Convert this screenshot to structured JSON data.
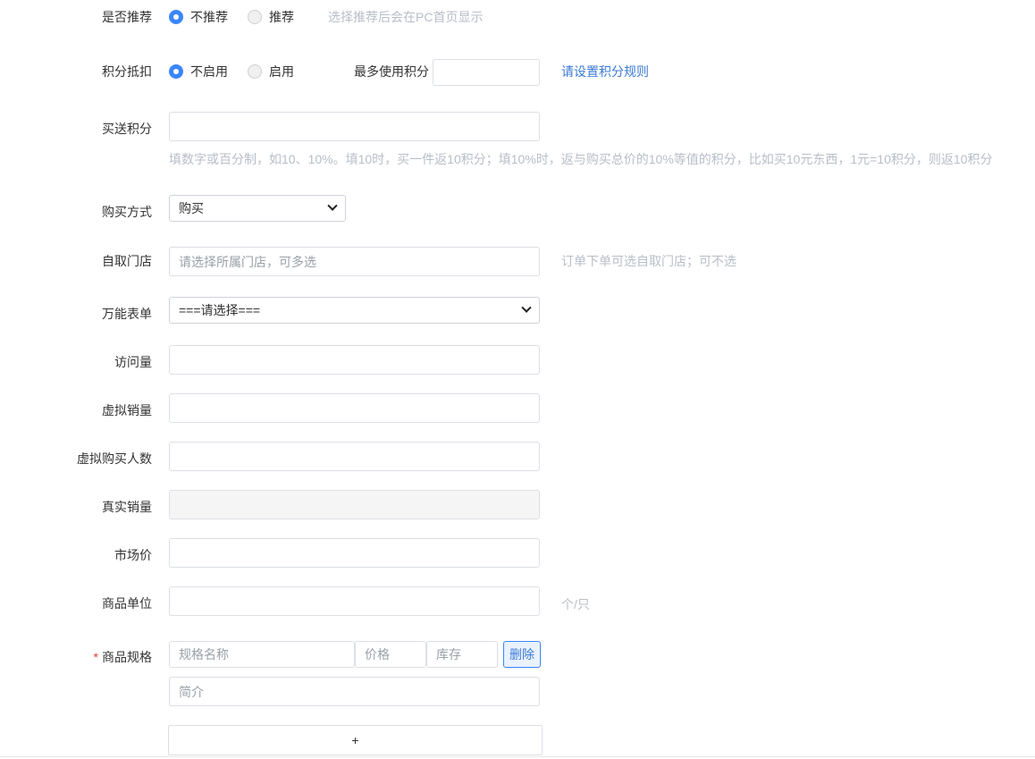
{
  "recommend": {
    "label": "是否推荐",
    "option_no": "不推荐",
    "option_yes": "推荐",
    "selected": "不推荐",
    "hint": "选择推荐后会在PC首页显示"
  },
  "points_deduct": {
    "label": "积分抵扣",
    "option_off": "不启用",
    "option_on": "启用",
    "selected": "不启用",
    "max_label": "最多使用积分",
    "max_value": "",
    "rules_link": "请设置积分规则"
  },
  "gift_points": {
    "label": "买送积分",
    "value": "",
    "hint": "填数字或百分制，如10、10%。填10时，买一件返10积分；填10%时，返与购买总价的10%等值的积分，比如买10元东西，1元=10积分，则返10积分"
  },
  "purchase_method": {
    "label": "购买方式",
    "selected": "购买"
  },
  "pickup_store": {
    "label": "自取门店",
    "placeholder": "请选择所属门店，可多选",
    "hint": "订单下单可选自取门店；可不选"
  },
  "universal_form": {
    "label": "万能表单",
    "selected": "===请选择==="
  },
  "views": {
    "label": "访问量",
    "value": ""
  },
  "virtual_sales": {
    "label": "虚拟销量",
    "value": ""
  },
  "virtual_buyers": {
    "label": "虚拟购买人数",
    "value": ""
  },
  "real_sales": {
    "label": "真实销量",
    "value": ""
  },
  "market_price": {
    "label": "市场价",
    "value": ""
  },
  "unit": {
    "label": "商品单位",
    "value": "",
    "hint": "个/只"
  },
  "spec": {
    "required_mark": "*",
    "label": "商品规格",
    "name_placeholder": "规格名称",
    "price_placeholder": "价格",
    "stock_placeholder": "库存",
    "delete_label": "删除",
    "intro_placeholder": "简介",
    "add_label": "+"
  },
  "colors": {
    "accent": "#3a86ff",
    "link": "#3a7bd5",
    "hint": "#b8bec8",
    "required": "#e4393c"
  }
}
